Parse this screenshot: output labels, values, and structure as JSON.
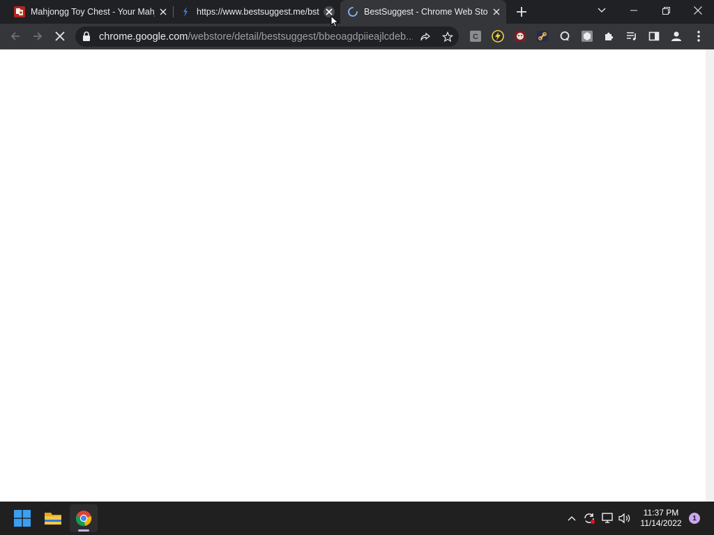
{
  "tabs": [
    {
      "title": "Mahjongg Toy Chest - Your Mahj",
      "favicon": "mahjongg-favicon",
      "active": false
    },
    {
      "title": "https://www.bestsuggest.me/bst",
      "favicon": "bestsuggest-favicon",
      "active": false
    },
    {
      "title": "BestSuggest - Chrome Web Store",
      "favicon": "loading-spinner",
      "active": true
    }
  ],
  "address_bar": {
    "host": "chrome.google.com",
    "path": "/webstore/detail/bestsuggest/bbeoagdpiieajlcdeb..."
  },
  "taskbar": {
    "time": "11:37 PM",
    "date": "11/14/2022",
    "notification_count": "1"
  },
  "colors": {
    "tabstrip": "#202124",
    "toolbar": "#35363a",
    "taskbar": "#202020",
    "windows_accent": "#3aa0f3"
  }
}
